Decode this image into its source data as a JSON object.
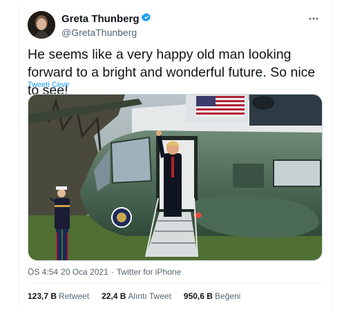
{
  "author": {
    "display_name": "Greta Thunberg",
    "handle": "@GretaThunberg",
    "verified_color": "#1d9bf0"
  },
  "tweet": {
    "text": "He seems like a very happy old man looking forward to a bright and wonderful future. So nice to see!",
    "translate_label": "Tweeti Çevir"
  },
  "meta": {
    "time": "ÖS 4:54",
    "separator": "·",
    "date": "20 Oca 2021",
    "source": "Twitter for iPhone"
  },
  "stats": [
    {
      "count": "123,7 B",
      "label": "Retweet"
    },
    {
      "count": "22,4 B",
      "label": "Alıntı Tweet"
    },
    {
      "count": "950,6 B",
      "label": "Beğeni"
    }
  ],
  "icons": {
    "verified": "verified-badge-icon",
    "more": "more-options-icon"
  },
  "colors": {
    "accent": "#1d9bf0",
    "text": "#0f1419",
    "secondary": "#536471",
    "helicopter": "#3c5a47"
  }
}
